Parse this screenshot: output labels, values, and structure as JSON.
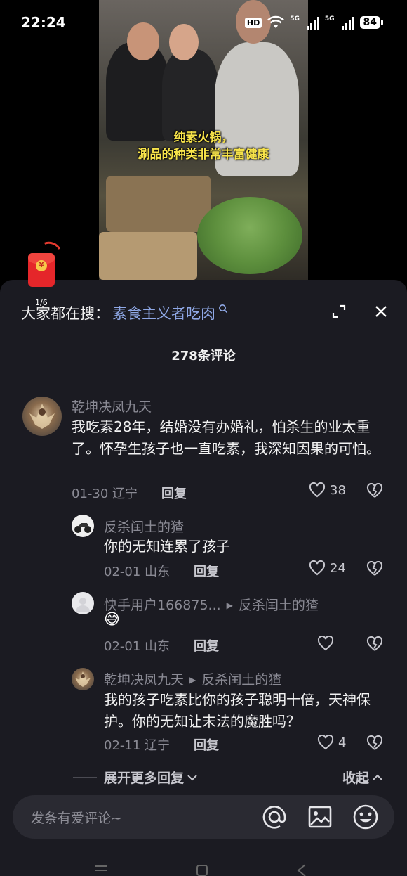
{
  "status_bar": {
    "time": "22:24",
    "hd": "HD",
    "network_1": "5G",
    "network_2": "5G",
    "battery": "84"
  },
  "video": {
    "caption_line1": "纯素火锅，",
    "caption_line2": "涮品的种类非常丰富健康"
  },
  "red_packet": {
    "counter": "1/6",
    "symbol": "¥"
  },
  "panel": {
    "search_prefix": "大家都在搜：",
    "search_term": "素食主义者吃肉",
    "comment_count": "278条评论"
  },
  "comments": [
    {
      "user": "乾坤决凤九天",
      "text": "我吃素28年，结婚没有办婚礼，怕杀生的业太重了。怀孕生孩子也一直吃素，我深知因果的可怕。",
      "date_loc": "01-30 辽宁",
      "reply_label": "回复",
      "likes": "38",
      "avatar": "phoenix-avatar"
    }
  ],
  "replies": [
    {
      "user": "反杀闰土的猹",
      "reply_to": "",
      "text": "你的无知连累了孩子",
      "date_loc": "02-01 山东",
      "reply_label": "回复",
      "likes": "24",
      "avatar": "motorcycle-avatar"
    },
    {
      "user": "快手用户166875...",
      "reply_to": "反杀闰土的猹",
      "text": "😅",
      "date_loc": "02-01 山东",
      "reply_label": "回复",
      "likes": "",
      "avatar": "default-avatar"
    },
    {
      "user": "乾坤决凤九天",
      "reply_to": "反杀闰土的猹",
      "text": "我的孩子吃素比你的孩子聪明十倍，天神保护。你的无知让末法的魔胜吗？",
      "date_loc": "02-11 辽宁",
      "reply_label": "回复",
      "likes": "4",
      "avatar": "phoenix-avatar"
    }
  ],
  "thread_controls": {
    "expand_more": "展开更多回复",
    "collapse": "收起"
  },
  "input": {
    "placeholder": "发条有爱评论~"
  },
  "colors": {
    "panel_bg": "#1b1b22",
    "link_blue": "#8fa8e6",
    "caption_yellow": "#f7e34a",
    "red_packet": "#e5262a"
  }
}
